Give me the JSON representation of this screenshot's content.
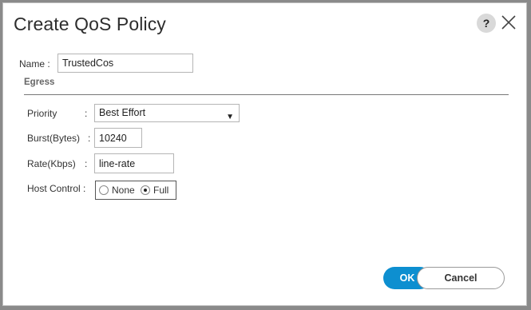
{
  "dialog": {
    "title": "Create QoS Policy",
    "help_label": "?"
  },
  "form": {
    "name_label": "Name :",
    "name_value": "TrustedCos",
    "section_label": "Egress",
    "priority_label": "Priority",
    "priority_sep": ":",
    "priority_value": "Best Effort",
    "burst_label": "Burst(Bytes)",
    "burst_sep": ":",
    "burst_value": "10240",
    "rate_label": "Rate(Kbps)",
    "rate_sep": ":",
    "rate_value": "line-rate",
    "host_control_label": "Host Control :",
    "host_control_options": [
      "None",
      "Full"
    ],
    "host_control_selected": "Full"
  },
  "buttons": {
    "ok_label": "OK",
    "cancel_label": "Cancel"
  },
  "colors": {
    "primary_button": "#0d8fd0",
    "page_background": "#8a8a8a"
  },
  "icons": {
    "help": "help-icon",
    "close": "close-icon",
    "dropdown": "chevron-down-icon"
  }
}
